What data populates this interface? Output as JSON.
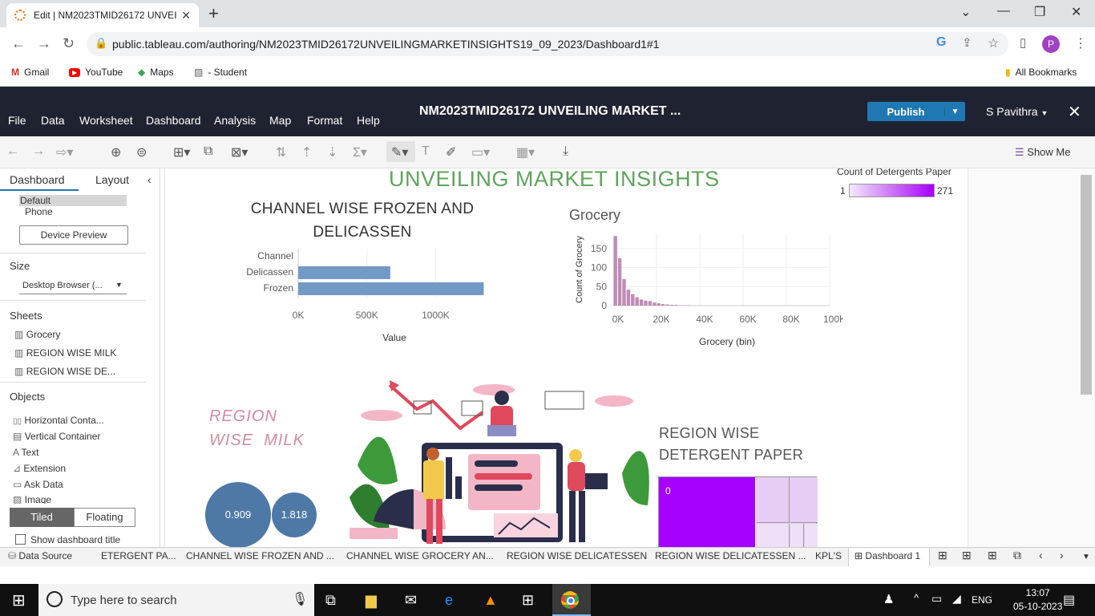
{
  "browser": {
    "tab_title": "Edit | NM2023TMID26172 UNVEI",
    "url": "public.tableau.com/authoring/NM2023TMID26172UNVEILINGMARKETINSIGHTS19_09_2023/Dashboard1#1",
    "bookmarks": [
      "Gmail",
      "YouTube",
      "Maps",
      "- Student"
    ],
    "all_bookmarks": "All Bookmarks",
    "profile_initial": "P"
  },
  "tableau": {
    "menu": [
      "File",
      "Data",
      "Worksheet",
      "Dashboard",
      "Analysis",
      "Map",
      "Format",
      "Help"
    ],
    "workbook_title": "NM2023TMID26172 UNVEILING MARKET ...",
    "publish": "Publish",
    "user": "S Pavithra",
    "show_me": "Show Me"
  },
  "left_pane": {
    "tabs": [
      "Dashboard",
      "Layout"
    ],
    "devices": [
      "Default",
      "Phone"
    ],
    "device_preview": "Device Preview",
    "size_label": "Size",
    "size_value": "Desktop Browser (...",
    "sheets_label": "Sheets",
    "sheets": [
      "Grocery",
      "REGION WISE MILK",
      "REGION WISE DE..."
    ],
    "objects_label": "Objects",
    "objects": [
      "Horizontal Conta...",
      "Vertical Container",
      "Text",
      "Extension",
      "Ask Data",
      "Image"
    ],
    "tiled": "Tiled",
    "floating": "Floating",
    "show_title": "Show dashboard title"
  },
  "dashboard": {
    "title": "UNVEILING MARKET INSIGHTS",
    "legend_title": "Count of Detergents Paper",
    "legend_min": "1",
    "legend_max": "271",
    "milk_title_1": "REGION",
    "milk_title_2": "WISE  MILK",
    "milk_bubbles": [
      "0.909",
      "1.818"
    ],
    "detergent_title_1": "REGION WISE",
    "detergent_title_2": "DETERGENT PAPER",
    "treemap_label": "0",
    "colors": {
      "title_green": "#5da55a",
      "bar_blue": "#7399c6",
      "hist_purple": "#c08bb6",
      "bubble_blue": "#4e79a7",
      "treemap_purple": "#a600ff"
    }
  },
  "chart_data": [
    {
      "type": "bar",
      "title_1": "CHANNEL WISE FROZEN AND",
      "title_2": "DELICASSEN",
      "categories": [
        "Channel",
        "Delicassen",
        "Frozen"
      ],
      "values": [
        0,
        670000,
        1350000
      ],
      "xlabel": "Value",
      "xticks": [
        "0K",
        "500K",
        "1000K"
      ],
      "xlim": [
        0,
        1400000
      ]
    },
    {
      "type": "bar",
      "title": "Grocery",
      "xlabel": "Grocery (bin)",
      "ylabel": "Count of Grocery",
      "bin_width": 2000,
      "x": [
        0,
        2000,
        4000,
        6000,
        8000,
        10000,
        12000,
        14000,
        16000,
        18000,
        20000,
        22000,
        24000,
        26000,
        28000,
        30000,
        32000,
        34000
      ],
      "values": [
        183,
        125,
        70,
        42,
        30,
        22,
        16,
        13,
        12,
        8,
        6,
        4,
        3,
        2,
        2,
        1,
        1,
        1
      ],
      "xticks": [
        "0K",
        "20K",
        "40K",
        "60K",
        "80K",
        "100K"
      ],
      "yticks": [
        "0",
        "50",
        "100",
        "150"
      ],
      "xlim": [
        0,
        100000
      ],
      "ylim": [
        0,
        190
      ]
    }
  ],
  "sheet_tabs": [
    "Data Source",
    "ETERGENT PA...",
    "CHANNEL WISE FROZEN AND ...",
    "CHANNEL WISE GROCERY AN...",
    "REGION WISE DELICATESSEN",
    "REGION WISE DELICATESSEN ...",
    "KPL'S",
    "Dashboard 1"
  ],
  "taskbar": {
    "search_placeholder": "Type here to search",
    "lang": "ENG",
    "time": "13:07",
    "date": "05-10-2023"
  }
}
